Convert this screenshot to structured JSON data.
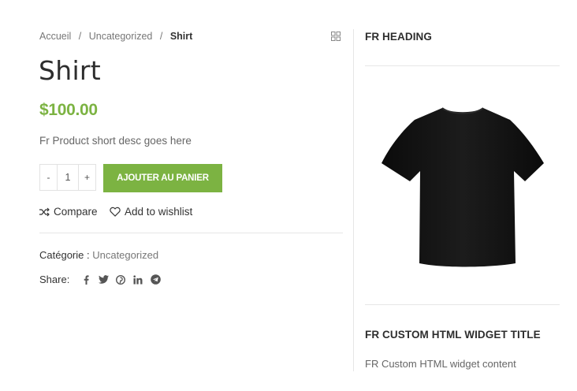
{
  "breadcrumb": {
    "home": "Accueil",
    "category": "Uncategorized",
    "current": "Shirt",
    "separator": "/"
  },
  "product": {
    "title": "Shirt",
    "price": "$100.00",
    "short_desc": "Fr Product short desc goes here",
    "quantity": {
      "minus": "-",
      "value": "1",
      "plus": "+"
    },
    "add_to_cart_label": "AJOUTER AU PANIER",
    "compare_label": "Compare",
    "wishlist_label": "Add to wishlist",
    "category_label": "Catégorie :",
    "category_value": "Uncategorized",
    "share_label": "Share:",
    "share_icons": [
      "facebook-icon",
      "twitter-icon",
      "pinterest-icon",
      "linkedin-icon",
      "telegram-icon"
    ]
  },
  "sidebar": {
    "heading": "FR HEADING",
    "widget_title": "FR CUSTOM HTML WIDGET TITLE",
    "widget_content": "FR Custom HTML widget content"
  },
  "colors": {
    "accent": "#7cb342",
    "text": "#333333",
    "muted": "#777777",
    "divider": "#e6e6e6"
  }
}
